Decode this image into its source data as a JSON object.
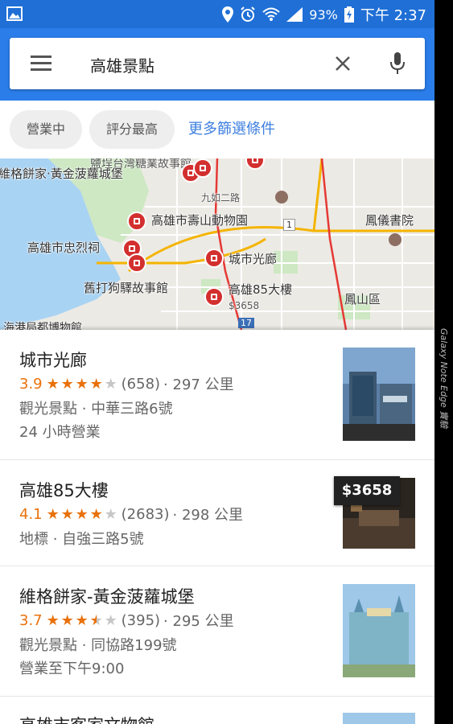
{
  "status_bar": {
    "battery_percent": "93%",
    "time": "下午 2:37"
  },
  "search": {
    "query": "高雄景點"
  },
  "filters": {
    "chips": [
      "營業中",
      "評分最高"
    ],
    "more_label": "更多篩選條件"
  },
  "map": {
    "labels": {
      "weige": "維格餅家·黃金菠蘿城堡",
      "shoushan_zoo": "高雄市壽山動物園",
      "martyrs_shrine": "高雄市忠烈祠",
      "city_gallery": "城市光廊",
      "dagou_museum": "舊打狗驛故事館",
      "tower85": "高雄85大樓",
      "tower85_price": "$3658",
      "fengyi_academy": "鳳儀書院",
      "fengshan": "鳳山區",
      "jiuru_road": "九如二路",
      "harbor_museum": "海港局都博物館",
      "top_partial": "鹽埕台灣糖業故事館",
      "route_1": "1",
      "route_17": "17"
    }
  },
  "results": [
    {
      "name": "城市光廊",
      "rating": "3.9",
      "stars": 4,
      "half": false,
      "reviews": "(658)",
      "distance": "· 297 公里",
      "detail": "觀光景點 · 中華三路6號",
      "extra": "24 小時營業"
    },
    {
      "name": "高雄85大樓",
      "rating": "4.1",
      "stars": 4,
      "half": false,
      "reviews": "(2683)",
      "distance": "· 298 公里",
      "detail": "地標 · 自強三路5號",
      "price": "$3658"
    },
    {
      "name": "維格餅家-黃金菠蘿城堡",
      "rating": "3.7",
      "stars": 3,
      "half": true,
      "reviews": "(395)",
      "distance": "· 295 公里",
      "detail": "觀光景點 · 同協路199號",
      "extra": "營業至下午9:00"
    },
    {
      "name": "高雄市客家文物館"
    }
  ],
  "watermark": "Galaxy Note Edge 實驗"
}
